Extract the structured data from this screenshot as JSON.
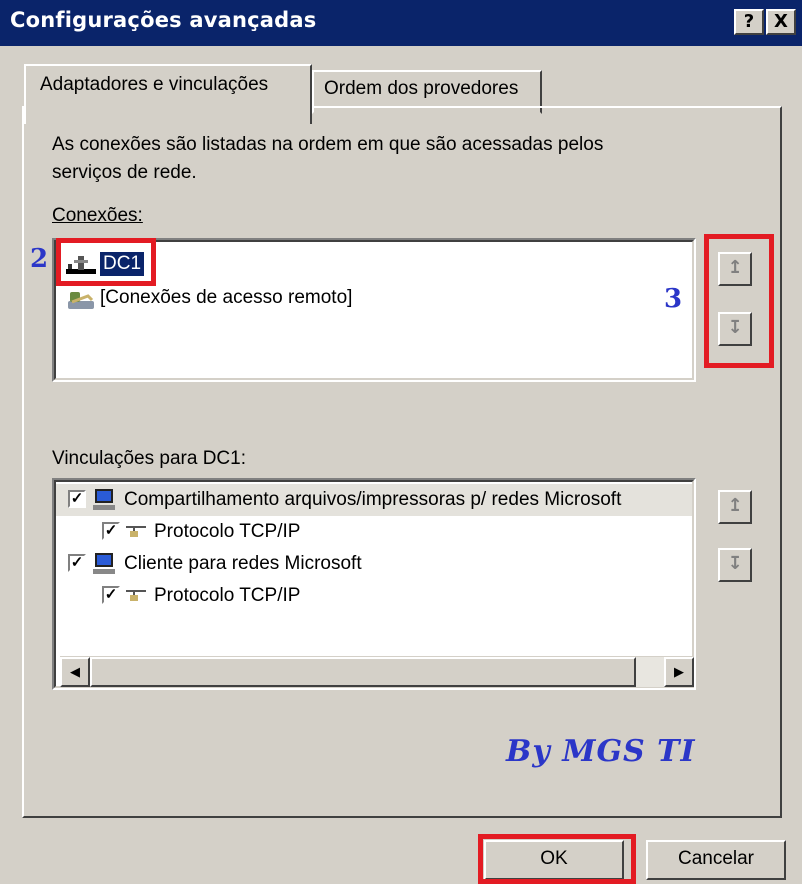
{
  "window": {
    "title": "Configurações avançadas",
    "help_btn": "?",
    "close_btn": "X"
  },
  "tabs": [
    {
      "label": "Adaptadores e vinculações",
      "active": true
    },
    {
      "label": "Ordem dos provedores",
      "active": false
    }
  ],
  "description": {
    "line1": "As conexões são listadas na ordem em que são acessadas pelos",
    "line2": "serviços de rede."
  },
  "connections": {
    "label": "Conexões:",
    "items": [
      {
        "label": "DC1",
        "icon": "network-adapter-icon",
        "selected": true
      },
      {
        "label": "[Conexões de acesso remoto]",
        "icon": "dialup-icon",
        "selected": false
      }
    ],
    "up_glyph": "↥",
    "down_glyph": "↧"
  },
  "bindings": {
    "label": "Vinculações para DC1:",
    "items": [
      {
        "label": "Compartilhamento arquivos/impressoras p/ redes Microsoft",
        "checked": true,
        "level": 0,
        "icon": "computer-icon"
      },
      {
        "label": "Protocolo TCP/IP",
        "checked": true,
        "level": 1,
        "icon": "protocol-icon"
      },
      {
        "label": "Cliente para redes Microsoft",
        "checked": true,
        "level": 0,
        "icon": "computer-icon"
      },
      {
        "label": "Protocolo TCP/IP",
        "checked": true,
        "level": 1,
        "icon": "protocol-icon"
      }
    ],
    "up_glyph": "↥",
    "down_glyph": "↧"
  },
  "annotations": {
    "marker_2": "2",
    "marker_3": "3",
    "watermark": "By MGS TI",
    "highlight_color": "#e31b23",
    "marker_color": "#2b36c8"
  },
  "buttons": {
    "ok": "OK",
    "cancel": "Cancelar"
  },
  "colors": {
    "titlebar": "#0a246a",
    "face": "#d4d0c8",
    "selection": "#0a246a"
  }
}
